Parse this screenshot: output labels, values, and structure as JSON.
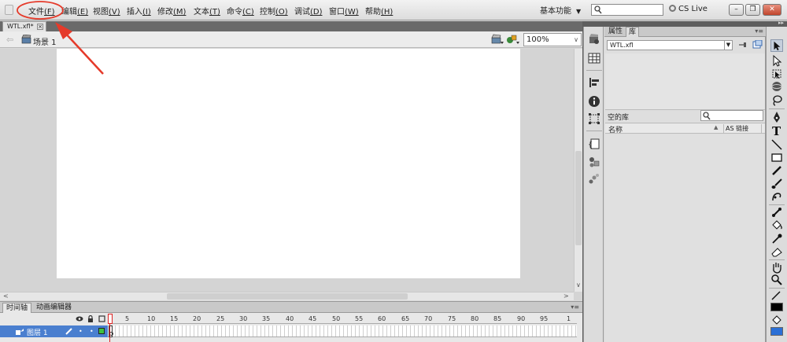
{
  "menubar": {
    "items": [
      {
        "text": "文件",
        "key": "(F)"
      },
      {
        "text": "编辑",
        "key": "(E)"
      },
      {
        "text": "视图",
        "key": "(V)"
      },
      {
        "text": "插入",
        "key": "(I)"
      },
      {
        "text": "修改",
        "key": "(M)"
      },
      {
        "text": "文本",
        "key": "(T)"
      },
      {
        "text": "命令",
        "key": "(C)"
      },
      {
        "text": "控制",
        "key": "(O)"
      },
      {
        "text": "调试",
        "key": "(D)"
      },
      {
        "text": "窗口",
        "key": "(W)"
      },
      {
        "text": "帮助",
        "key": "(H)"
      }
    ],
    "workspace": "基本功能",
    "cs_live": "CS Live"
  },
  "document": {
    "tab": "WTL.xfl*",
    "scene": "场景 1",
    "zoom": "100%"
  },
  "timeline": {
    "tabs": [
      "时间轴",
      "动画编辑器"
    ],
    "layer_name": "图层 1",
    "frame_ticks": [
      "1",
      "5",
      "10",
      "15",
      "20",
      "25",
      "30",
      "35",
      "40",
      "45",
      "50",
      "55",
      "60",
      "65",
      "70",
      "75",
      "80",
      "85",
      "90",
      "95",
      "1"
    ]
  },
  "panel": {
    "tabs": [
      "属性",
      "库"
    ],
    "doc_select": "WTL.xfl",
    "status": "空的库",
    "col_name": "名称",
    "col_link": "AS 链接"
  },
  "colors": {
    "annotation": "#e53a2a",
    "layer_selected": "#4a7fcf",
    "playhead": "#dd2222"
  }
}
